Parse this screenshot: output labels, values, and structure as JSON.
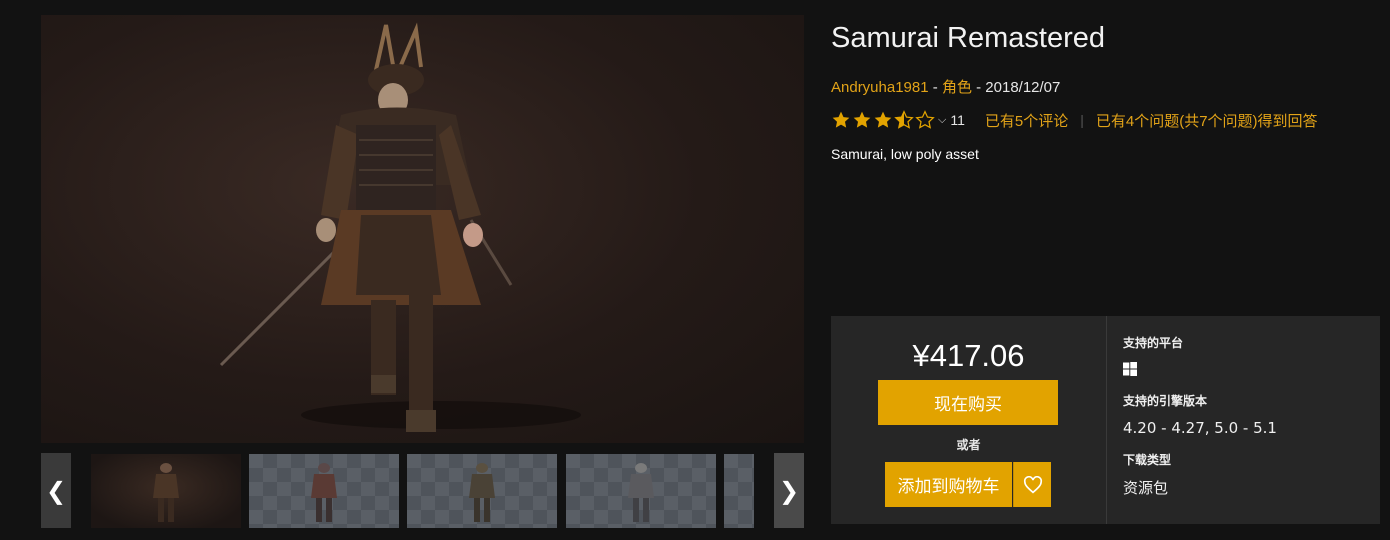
{
  "product": {
    "title": "Samurai Remastered",
    "author": "Andryuha1981",
    "category": "角色",
    "date": "2018/12/07",
    "meta_sep": " - ",
    "rating": 3.5,
    "rating_max": 5,
    "rating_count": "11",
    "reviews_link": "已有5个评论",
    "questions_link": "已有4个问题(共7个问题)得到回答",
    "description": "Samurai, low poly asset"
  },
  "purchase": {
    "price": "¥417.06",
    "buy_now_label": "现在购买",
    "or_label": "或者",
    "add_to_cart_label": "添加到购物车",
    "wishlist_icon": "heart-icon"
  },
  "details": {
    "platforms_heading": "支持的平台",
    "platform_icon": "windows-icon",
    "engine_heading": "支持的引擎版本",
    "engine_versions": "4.20 - 4.27, 5.0 - 5.1",
    "download_type_heading": "下载类型",
    "download_type": "资源包"
  },
  "gallery": {
    "prev_icon": "chevron-left-icon",
    "next_icon": "chevron-right-icon",
    "prev_glyph": "❮",
    "next_glyph": "❯"
  },
  "colors": {
    "accent": "#e2a300",
    "link": "#e2a318",
    "background": "#121212",
    "panel": "#262626"
  }
}
